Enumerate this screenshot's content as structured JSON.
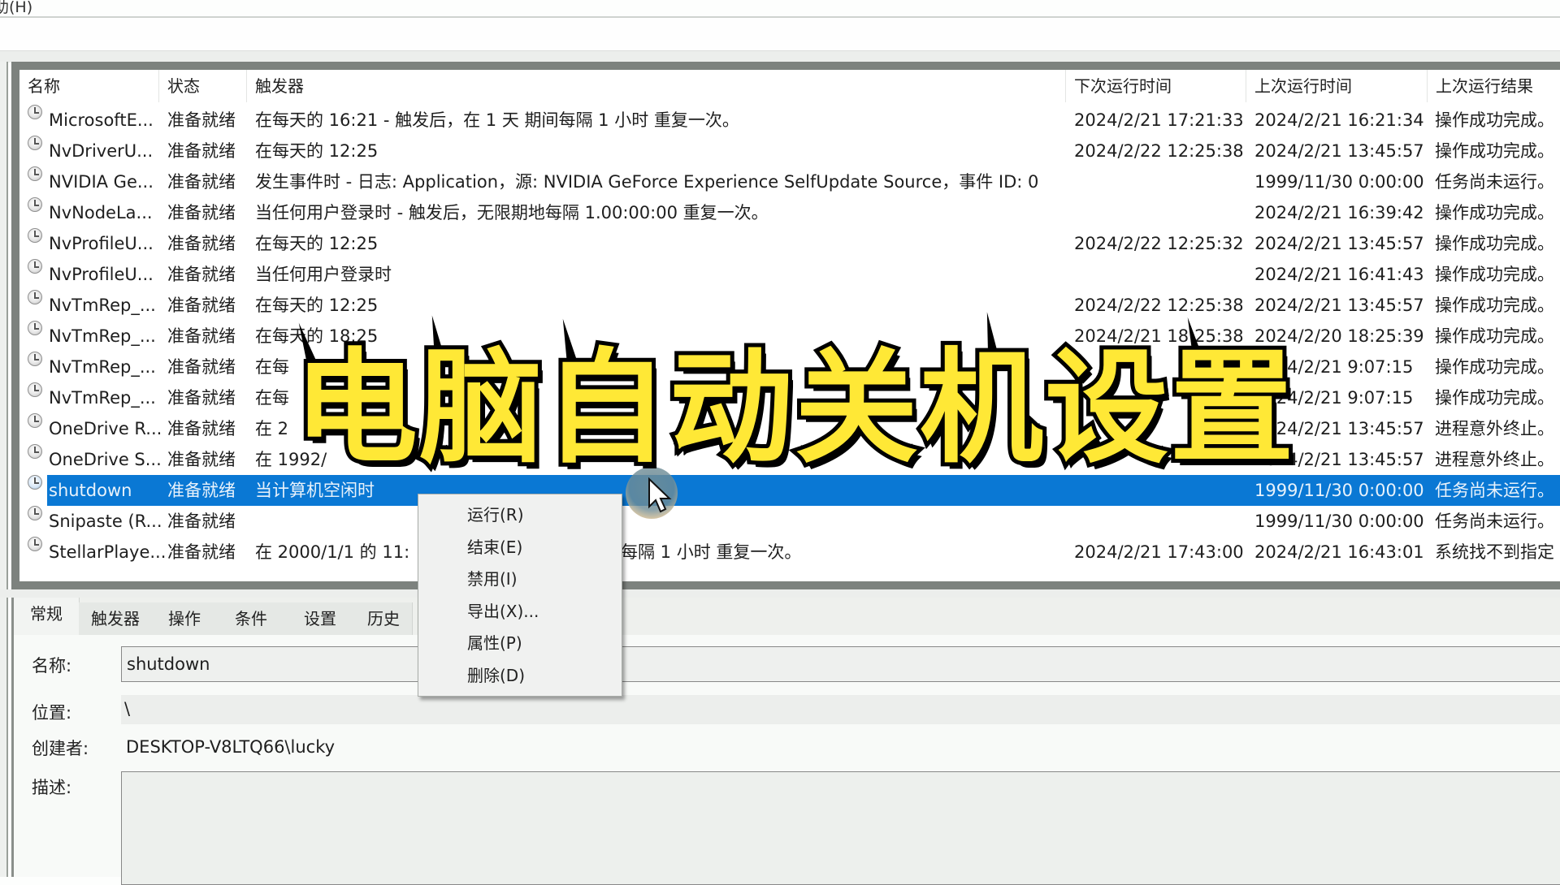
{
  "menubar": {
    "partial_menu_label": "助(H)"
  },
  "task_list": {
    "columns": [
      "名称",
      "状态",
      "触发器",
      "下次运行时间",
      "上次运行时间",
      "上次运行结果"
    ],
    "rows": [
      {
        "name": "MicrosoftE...",
        "status": "准备就绪",
        "trigger": "在每天的 16:21 - 触发后，在 1 天 期间每隔 1 小时 重复一次。",
        "next_run": "2024/2/21 17:21:33",
        "last_run": "2024/2/21 16:21:34",
        "last_result": "操作成功完成。",
        "selected": false
      },
      {
        "name": "NvDriverU...",
        "status": "准备就绪",
        "trigger": "在每天的 12:25",
        "next_run": "2024/2/22 12:25:38",
        "last_run": "2024/2/21 13:45:57",
        "last_result": "操作成功完成。",
        "selected": false
      },
      {
        "name": "NVIDIA Ge...",
        "status": "准备就绪",
        "trigger": "发生事件时 - 日志: Application，源: NVIDIA GeForce Experience SelfUpdate Source，事件 ID: 0",
        "next_run": "",
        "last_run": "1999/11/30 0:00:00",
        "last_result": "任务尚未运行。",
        "selected": false
      },
      {
        "name": "NvNodeLa...",
        "status": "准备就绪",
        "trigger": "当任何用户登录时 - 触发后，无限期地每隔 1.00:00:00 重复一次。",
        "next_run": "",
        "last_run": "2024/2/21 16:39:42",
        "last_result": "操作成功完成。",
        "selected": false
      },
      {
        "name": "NvProfileU...",
        "status": "准备就绪",
        "trigger": "在每天的 12:25",
        "next_run": "2024/2/22 12:25:32",
        "last_run": "2024/2/21 13:45:57",
        "last_result": "操作成功完成。",
        "selected": false
      },
      {
        "name": "NvProfileU...",
        "status": "准备就绪",
        "trigger": "当任何用户登录时",
        "next_run": "",
        "last_run": "2024/2/21 16:41:43",
        "last_result": "操作成功完成。",
        "selected": false
      },
      {
        "name": "NvTmRep_...",
        "status": "准备就绪",
        "trigger": "在每天的 12:25",
        "next_run": "2024/2/22 12:25:38",
        "last_run": "2024/2/21 13:45:57",
        "last_result": "操作成功完成。",
        "selected": false
      },
      {
        "name": "NvTmRep_...",
        "status": "准备就绪",
        "trigger": "在每天的 18:25",
        "next_run": "2024/2/21 18:25:38",
        "last_run": "2024/2/20 18:25:39",
        "last_result": "操作成功完成。",
        "selected": false
      },
      {
        "name": "NvTmRep_...",
        "status": "准备就绪",
        "trigger": "在每",
        "next_run": "",
        "last_run": "2024/2/21 9:07:15",
        "last_result": "操作成功完成。",
        "selected": false
      },
      {
        "name": "NvTmRep_...",
        "status": "准备就绪",
        "trigger": "在每",
        "next_run": "",
        "last_run": "2024/2/21 9:07:15",
        "last_result": "操作成功完成。",
        "selected": false
      },
      {
        "name": "OneDrive R...",
        "status": "准备就绪",
        "trigger": "在 2",
        "next_run": "",
        "last_run": "2024/2/21 13:45:57",
        "last_result": "进程意外终止。",
        "selected": false
      },
      {
        "name": "OneDrive S...",
        "status": "准备就绪",
        "trigger": "在 1992/",
        "next_run": "",
        "last_run": "2024/2/21 13:45:57",
        "last_result": "进程意外终止。",
        "selected": false
      },
      {
        "name": "shutdown",
        "status": "准备就绪",
        "trigger": "当计算机空闲时",
        "next_run": "",
        "last_run": "1999/11/30 0:00:00",
        "last_result": "任务尚未运行。",
        "selected": true
      },
      {
        "name": "Snipaste (R...",
        "status": "准备就绪",
        "trigger": "",
        "next_run": "",
        "last_run": "1999/11/30 0:00:00",
        "last_result": "任务尚未运行。",
        "selected": false
      },
      {
        "name": "StellarPlaye...",
        "status": "准备就绪",
        "trigger": "在 2000/1/1 的 11:",
        "trigger_tail": "每隔 1 小时 重复一次。",
        "next_run": "2024/2/21 17:43:00",
        "last_run": "2024/2/21 16:43:01",
        "last_result": "系统找不到指定",
        "selected": false
      }
    ]
  },
  "context_menu": {
    "items": [
      "运行(R)",
      "结束(E)",
      "禁用(I)",
      "导出(X)...",
      "属性(P)",
      "删除(D)"
    ]
  },
  "details": {
    "tabs": [
      "常规",
      "触发器",
      "操作",
      "条件",
      "设置",
      "历史"
    ],
    "active_tab": "常规",
    "name_label": "名称:",
    "name_value": "shutdown",
    "location_label": "位置:",
    "location_value": "\\",
    "author_label": "创建者:",
    "author_value": "DESKTOP-V8LTQ66\\lucky",
    "description_label": "描述:",
    "description_value": ""
  },
  "overlay": {
    "title": "电脑自动关机设置",
    "text_color": "#ffe836",
    "outline_color": "#000000"
  },
  "colors": {
    "selection": "#0a78d4"
  }
}
